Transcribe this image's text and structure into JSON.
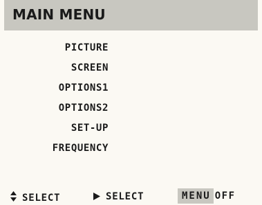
{
  "header": {
    "title": "MAIN MENU"
  },
  "menu": {
    "items": [
      {
        "label": "PICTURE"
      },
      {
        "label": "SCREEN"
      },
      {
        "label": "OPTIONS1"
      },
      {
        "label": "OPTIONS2"
      },
      {
        "label": "SET-UP"
      },
      {
        "label": "FREQUENCY"
      }
    ]
  },
  "footer": {
    "updown_hint": {
      "icon": "up-down-arrows-icon",
      "label": "SELECT"
    },
    "right_hint": {
      "icon": "right-arrow-icon",
      "label": "SELECT"
    },
    "menu_key": "MENU",
    "off_label": "OFF"
  },
  "colors": {
    "background": "#fbf9f3",
    "header_band": "#c8c7c0",
    "text": "#1a1a1a",
    "key_highlight": "#c8c7c0"
  }
}
